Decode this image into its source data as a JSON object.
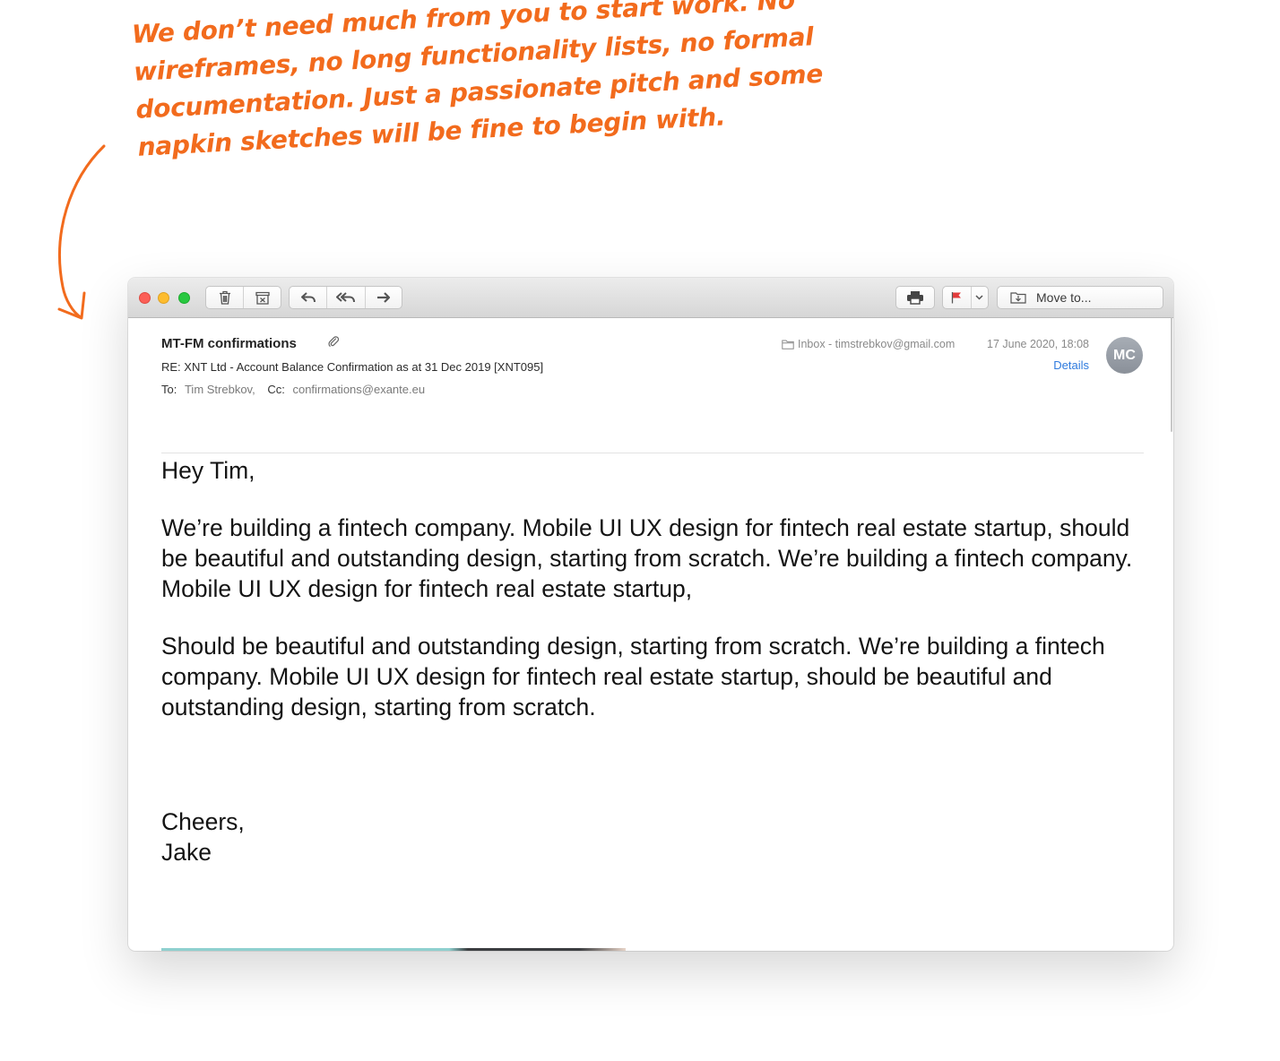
{
  "annotation": {
    "text": "We don’t need much from you to start work. No wireframes, no long functionality lists, no formal documentation. Just a passionate pitch and some napkin sketches will be fine to begin with.",
    "color": "#f26b1d"
  },
  "toolbar": {
    "icons": [
      "trash-icon",
      "archive-icon",
      "reply-icon",
      "reply-all-icon",
      "forward-icon",
      "print-icon",
      "flag-icon",
      "chevron-down-icon",
      "move-icon"
    ],
    "move_to_label": "Move to...",
    "flag_color": "#e23d3d"
  },
  "email": {
    "sender": "MT-FM confirmations",
    "subject": "RE: XNT Ltd - Account Balance Confirmation as at 31 Dec 2019 [XNT095]",
    "to_label": "To:",
    "to_value": "Tim Strebkov,",
    "cc_label": "Cc:",
    "cc_value": "confirmations@exante.eu",
    "mailbox": "Inbox - timstrebkov@gmail.com",
    "date": "17 June 2020, 18:08",
    "details_label": "Details",
    "avatar_initials": "MC",
    "greeting": "Hey Tim,",
    "paragraphs": [
      "We’re building a fintech company. Mobile UI UX design for fintech real estate startup, should be beautiful and outstanding design, starting from scratch. We’re building a fintech company. Mobile UI UX design for fintech real estate startup,",
      "Should be beautiful and outstanding design, starting from scratch. We’re building a fintech company. Mobile UI UX design for fintech real estate startup, should be beautiful and outstanding design, starting from scratch."
    ],
    "closing": "Cheers,",
    "signature": "Jake"
  }
}
